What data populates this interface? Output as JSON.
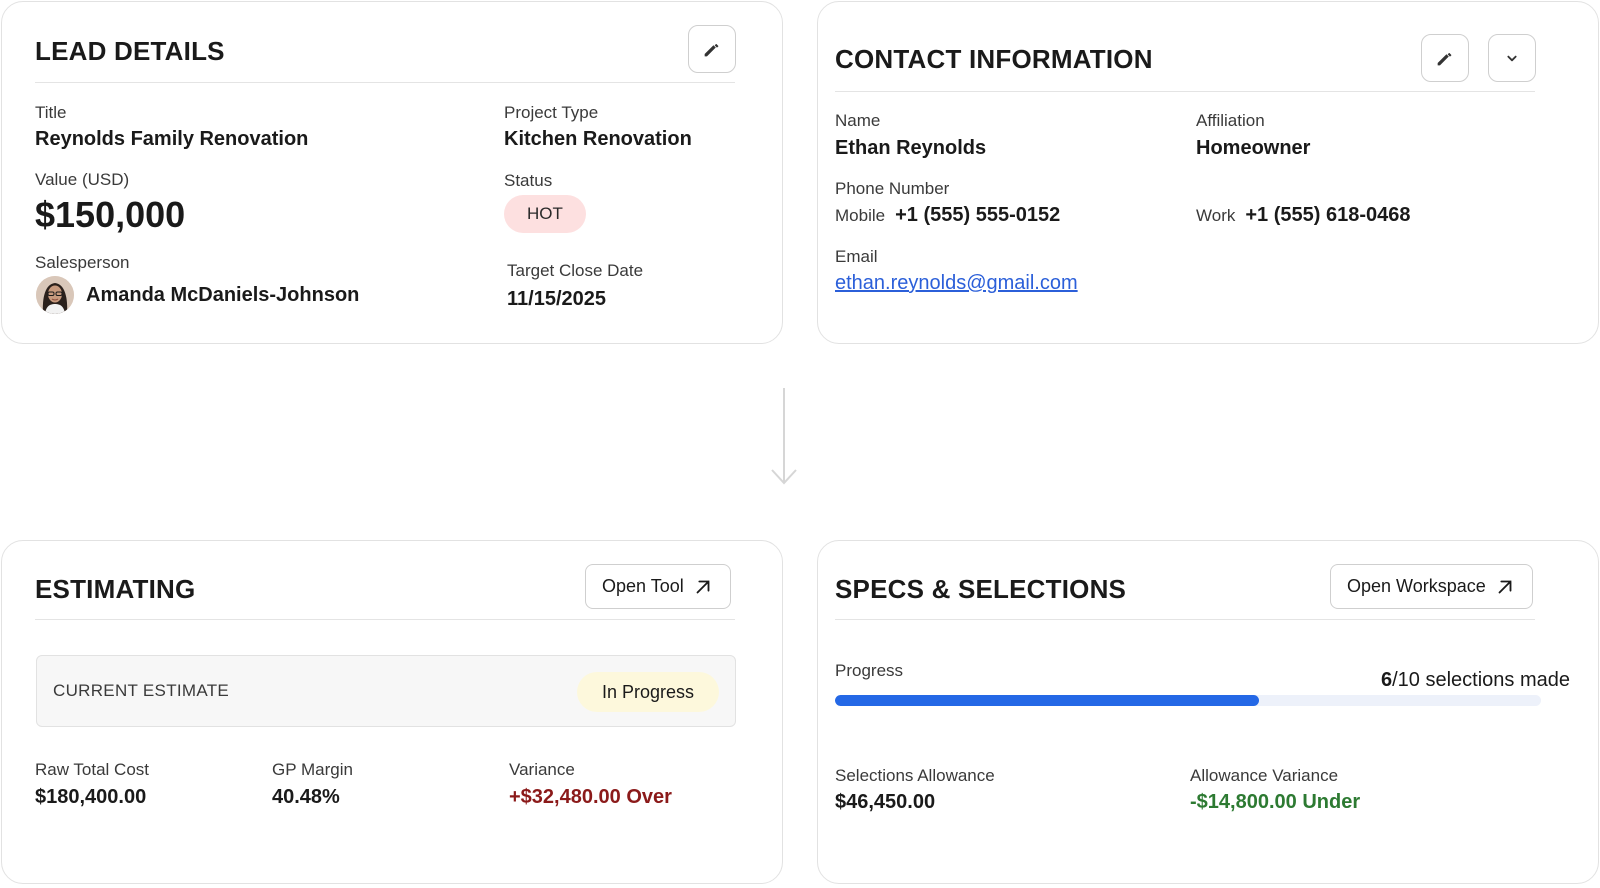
{
  "lead": {
    "title": "LEAD DETAILS",
    "edit_icon": "pencil-icon",
    "title_label": "Title",
    "title_value": "Reynolds Family Renovation",
    "project_type_label": "Project Type",
    "project_type_value": "Kitchen Renovation",
    "value_label": "Value (USD)",
    "value_value": "$150,000",
    "status_label": "Status",
    "status_value": "HOT",
    "salesperson_label": "Salesperson",
    "salesperson_value": "Amanda McDaniels-Johnson",
    "target_close_label": "Target Close Date",
    "target_close_value": "11/15/2025"
  },
  "contact": {
    "title": "CONTACT INFORMATION",
    "edit_icon": "pencil-icon",
    "expand_icon": "chevron-down-icon",
    "name_label": "Name",
    "name_value": "Ethan Reynolds",
    "affiliation_label": "Affiliation",
    "affiliation_value": "Homeowner",
    "phone_label": "Phone Number",
    "mobile_label": "Mobile",
    "mobile_value": "+1 (555) 555-0152",
    "work_label": "Work",
    "work_value": "+1 (555) 618-0468",
    "email_label": "Email",
    "email_value": "ethan.reynolds@gmail.com"
  },
  "estimating": {
    "title": "ESTIMATING",
    "open_button": "Open Tool",
    "current_label": "CURRENT ESTIMATE",
    "current_status": "In Progress",
    "raw_cost_label": "Raw Total Cost",
    "raw_cost_value": "$180,400.00",
    "gp_label": "GP Margin",
    "gp_value": "40.48%",
    "variance_label": "Variance",
    "variance_value": "+$32,480.00 Over"
  },
  "specs": {
    "title": "SPECS & SELECTIONS",
    "open_button": "Open Workspace",
    "progress_label": "Progress",
    "progress_made": "6",
    "progress_total_text": "/10 selections made",
    "progress_fraction": 0.6,
    "allowance_label": "Selections Allowance",
    "allowance_value": "$46,450.00",
    "allowance_variance_label": "Allowance Variance",
    "allowance_variance_value": "-$14,800.00 Under"
  },
  "colors": {
    "accent": "#2468e6",
    "hot_badge": "#fde0e0",
    "progress_badge": "#fdf8dc",
    "over": "#8b1a1a",
    "under": "#2d7a32",
    "link": "#2b5fd9"
  }
}
